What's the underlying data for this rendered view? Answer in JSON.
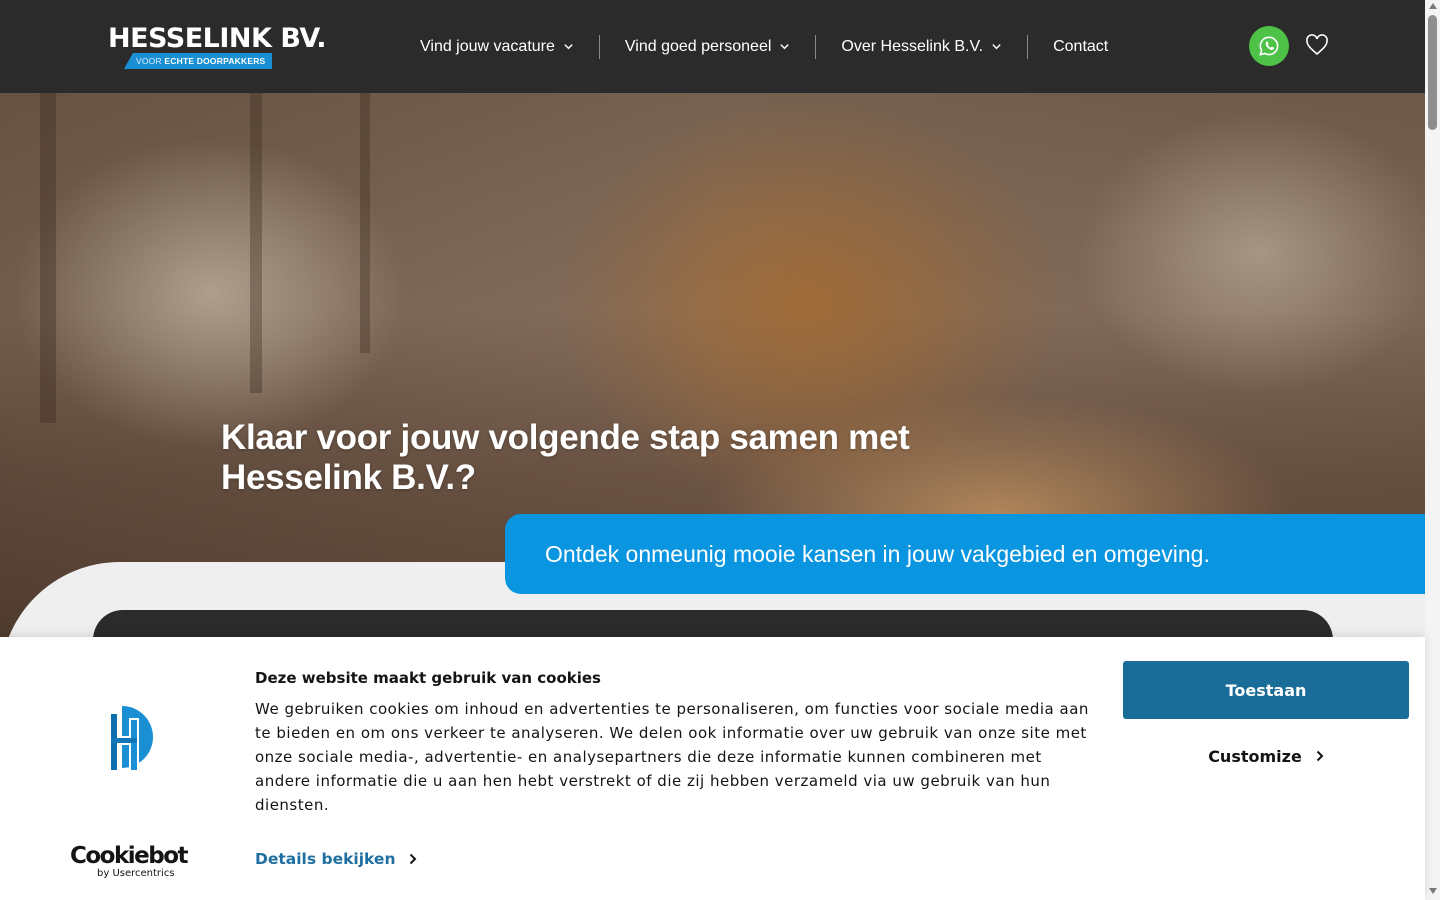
{
  "header": {
    "logo": {
      "brand": "HESSELINK BV.",
      "tagline_light": "VOOR",
      "tagline_bold": "ECHTE DOORPAKKERS"
    },
    "nav": [
      {
        "label": "Vind jouw vacature",
        "has_dropdown": true
      },
      {
        "label": "Vind goed personeel",
        "has_dropdown": true
      },
      {
        "label": "Over Hesselink B.V.",
        "has_dropdown": true
      },
      {
        "label": "Contact",
        "has_dropdown": false
      }
    ],
    "whatsapp_icon": "whatsapp-icon",
    "favorites_icon": "heart-icon"
  },
  "hero": {
    "title": "Klaar voor jouw volgende stap samen met Hesselink B.V.?",
    "banner_text": "Ontdek onmeunig mooie kansen in jouw vakgebied en omgeving."
  },
  "cookie_banner": {
    "title": "Deze website maakt gebruik van cookies",
    "text": "We gebruiken cookies om inhoud en advertenties te personaliseren, om functies voor sociale media aan te bieden en om ons verkeer te analyseren. We delen ook informatie over uw gebruik van onze site met onze sociale media-, advertentie- en analysepartners die deze informatie kunnen combineren met andere informatie die u aan hen hebt verstrekt of die zij hebben verzameld via uw gebruik van hun diensten.",
    "details_link": "Details bekijken",
    "allow_button": "Toestaan",
    "customize_button": "Customize",
    "brand_name": "Cookiebot",
    "brand_by": "by Usercentrics"
  },
  "colors": {
    "header_bg": "#2b2b2b",
    "accent_blue": "#0a95e0",
    "allow_button": "#1b6d99",
    "whatsapp_green": "#4dc247",
    "link_blue": "#1f6fa0"
  }
}
